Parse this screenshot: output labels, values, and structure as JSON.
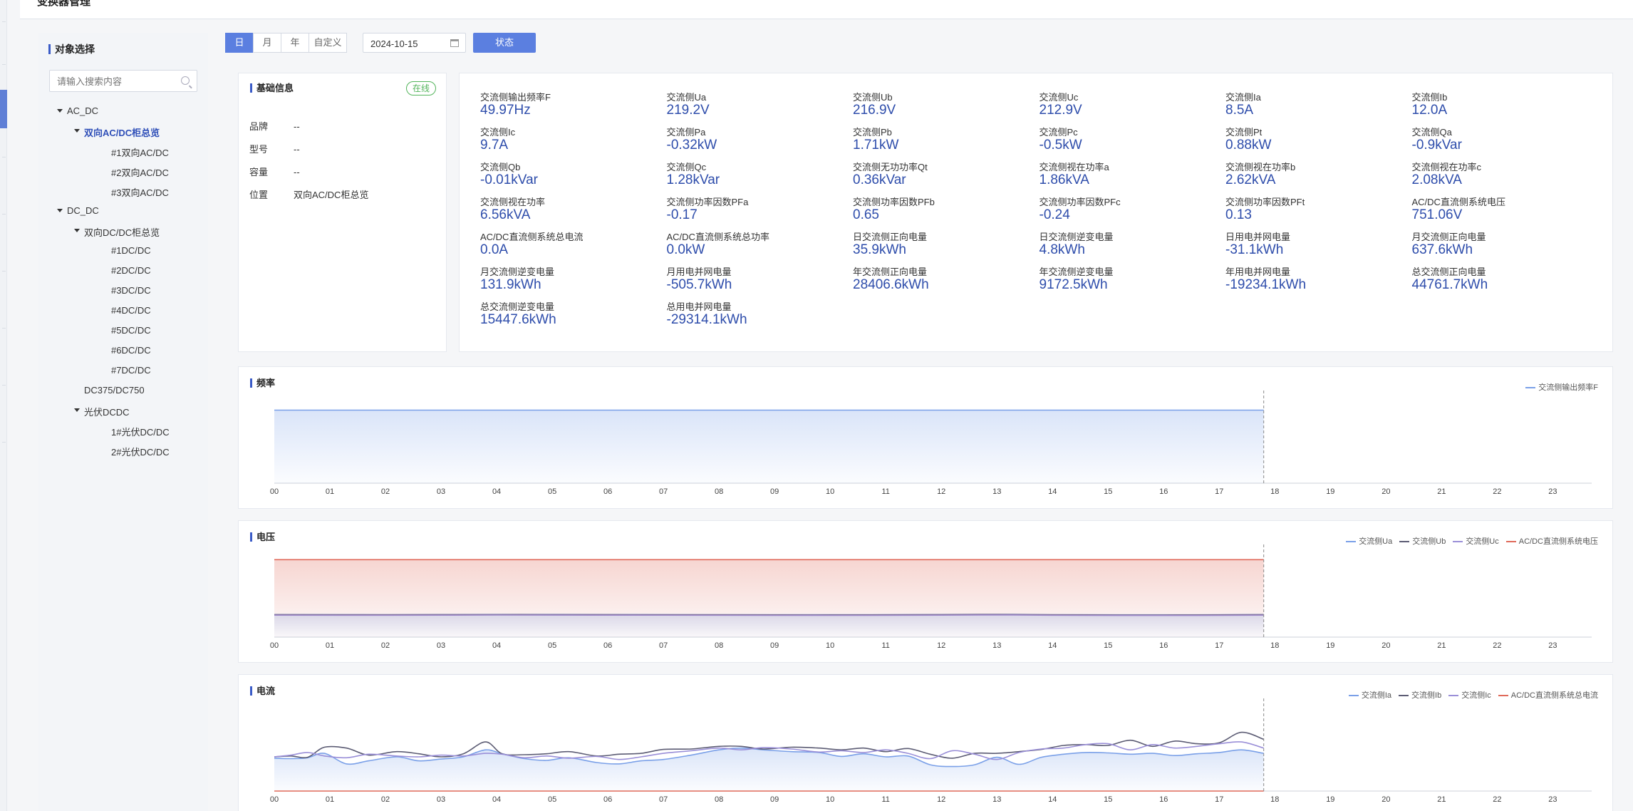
{
  "page": {
    "title": "变换器管理"
  },
  "sidebar": {
    "title": "对象选择",
    "search_placeholder": "请输入搜索内容",
    "tree": [
      {
        "label": "AC_DC",
        "level": 0,
        "expanded": true
      },
      {
        "label": "双向AC/DC柜总览",
        "level": 1,
        "expanded": true,
        "active": true
      },
      {
        "label": "#1双向AC/DC",
        "level": 2
      },
      {
        "label": "#2双向AC/DC",
        "level": 2
      },
      {
        "label": "#3双向AC/DC",
        "level": 2
      },
      {
        "label": "DC_DC",
        "level": 0,
        "expanded": true
      },
      {
        "label": "双向DC/DC柜总览",
        "level": 1,
        "expanded": true
      },
      {
        "label": "#1DC/DC",
        "level": 2
      },
      {
        "label": "#2DC/DC",
        "level": 2
      },
      {
        "label": "#3DC/DC",
        "level": 2
      },
      {
        "label": "#4DC/DC",
        "level": 2
      },
      {
        "label": "#5DC/DC",
        "level": 2
      },
      {
        "label": "#6DC/DC",
        "level": 2
      },
      {
        "label": "#7DC/DC",
        "level": 2
      },
      {
        "label": "DC375/DC750",
        "level": 1
      },
      {
        "label": "光伏DCDC",
        "level": 1,
        "expanded": true
      },
      {
        "label": "1#光伏DC/DC",
        "level": 2
      },
      {
        "label": "2#光伏DC/DC",
        "level": 2
      }
    ]
  },
  "toolbar": {
    "periods": [
      "日",
      "月",
      "年",
      "自定义"
    ],
    "selected_period": "日",
    "date": "2024-10-15",
    "status_label": "状态"
  },
  "info": {
    "title": "基础信息",
    "status": "在线",
    "rows": [
      {
        "key": "品牌",
        "value": "--"
      },
      {
        "key": "型号",
        "value": "--"
      },
      {
        "key": "容量",
        "value": "--"
      },
      {
        "key": "位置",
        "value": "双向AC/DC柜总览"
      }
    ]
  },
  "metrics": [
    {
      "label": "交流侧输出频率F",
      "value": "49.97Hz"
    },
    {
      "label": "交流侧Ua",
      "value": "219.2V"
    },
    {
      "label": "交流侧Ub",
      "value": "216.9V"
    },
    {
      "label": "交流侧Uc",
      "value": "212.9V"
    },
    {
      "label": "交流侧Ia",
      "value": "8.5A"
    },
    {
      "label": "交流侧Ib",
      "value": "12.0A"
    },
    {
      "label": "交流侧Ic",
      "value": "9.7A"
    },
    {
      "label": "交流侧Pa",
      "value": "-0.32kW"
    },
    {
      "label": "交流侧Pb",
      "value": "1.71kW"
    },
    {
      "label": "交流侧Pc",
      "value": "-0.5kW"
    },
    {
      "label": "交流侧Pt",
      "value": "0.88kW"
    },
    {
      "label": "交流侧Qa",
      "value": "-0.9kVar"
    },
    {
      "label": "交流侧Qb",
      "value": "-0.01kVar"
    },
    {
      "label": "交流侧Qc",
      "value": "1.28kVar"
    },
    {
      "label": "交流侧无功功率Qt",
      "value": "0.36kVar"
    },
    {
      "label": "交流侧视在功率a",
      "value": "1.86kVA"
    },
    {
      "label": "交流侧视在功率b",
      "value": "2.62kVA"
    },
    {
      "label": "交流侧视在功率c",
      "value": "2.08kVA"
    },
    {
      "label": "交流侧视在功率",
      "value": "6.56kVA"
    },
    {
      "label": "交流侧功率因数PFa",
      "value": "-0.17"
    },
    {
      "label": "交流侧功率因数PFb",
      "value": "0.65"
    },
    {
      "label": "交流侧功率因数PFc",
      "value": "-0.24"
    },
    {
      "label": "交流侧功率因数PFt",
      "value": "0.13"
    },
    {
      "label": "AC/DC直流侧系统电压",
      "value": "751.06V"
    },
    {
      "label": "AC/DC直流侧系统总电流",
      "value": "0.0A"
    },
    {
      "label": "AC/DC直流侧系统总功率",
      "value": "0.0kW"
    },
    {
      "label": "日交流侧正向电量",
      "value": "35.9kWh"
    },
    {
      "label": "日交流侧逆变电量",
      "value": "4.8kWh"
    },
    {
      "label": "日用电并网电量",
      "value": "-31.1kWh"
    },
    {
      "label": "月交流侧正向电量",
      "value": "637.6kWh"
    },
    {
      "label": "月交流侧逆变电量",
      "value": "131.9kWh"
    },
    {
      "label": "月用电并网电量",
      "value": "-505.7kWh"
    },
    {
      "label": "年交流侧正向电量",
      "value": "28406.6kWh"
    },
    {
      "label": "年交流侧逆变电量",
      "value": "9172.5kWh"
    },
    {
      "label": "年用电并网电量",
      "value": "-19234.1kWh"
    },
    {
      "label": "总交流侧正向电量",
      "value": "44761.7kWh"
    },
    {
      "label": "总交流侧逆变电量",
      "value": "15447.6kWh"
    },
    {
      "label": "总用电并网电量",
      "value": "-29314.1kWh"
    }
  ],
  "chart_data": [
    {
      "type": "area",
      "title": "频率",
      "x": [
        "00",
        "01",
        "02",
        "03",
        "04",
        "05",
        "06",
        "07",
        "08",
        "09",
        "10",
        "11",
        "12",
        "13",
        "14",
        "15",
        "16",
        "17",
        "18",
        "19",
        "20",
        "21",
        "22",
        "23"
      ],
      "current_time": 17.8,
      "ylim": [
        0,
        60
      ],
      "series": [
        {
          "name": "交流侧输出频率F",
          "color": "#7aa0e8",
          "fill": true,
          "points": [
            [
              0,
              50
            ],
            [
              1,
              50
            ],
            [
              2,
              50
            ],
            [
              3,
              50
            ],
            [
              4,
              50
            ],
            [
              5,
              50
            ],
            [
              6,
              50
            ],
            [
              7,
              50
            ],
            [
              8,
              50
            ],
            [
              9,
              50
            ],
            [
              10,
              50
            ],
            [
              11,
              50
            ],
            [
              12,
              50
            ],
            [
              13,
              50
            ],
            [
              14,
              50
            ],
            [
              15,
              50
            ],
            [
              16,
              50
            ],
            [
              17,
              50
            ],
            [
              17.8,
              50
            ]
          ]
        }
      ]
    },
    {
      "type": "area",
      "title": "电压",
      "x": [
        "00",
        "01",
        "02",
        "03",
        "04",
        "05",
        "06",
        "07",
        "08",
        "09",
        "10",
        "11",
        "12",
        "13",
        "14",
        "15",
        "16",
        "17",
        "18",
        "19",
        "20",
        "21",
        "22",
        "23"
      ],
      "current_time": 17.8,
      "ylim": [
        0,
        850
      ],
      "series": [
        {
          "name": "交流侧Ua",
          "color": "#7aa0e8",
          "fill": true,
          "points": [
            [
              0,
              219
            ],
            [
              2,
              218
            ],
            [
              4,
              220
            ],
            [
              6,
              219
            ],
            [
              8,
              218
            ],
            [
              10,
              217
            ],
            [
              12,
              219
            ],
            [
              13,
              221
            ],
            [
              14,
              218
            ],
            [
              16,
              216
            ],
            [
              17.8,
              219
            ]
          ]
        },
        {
          "name": "交流侧Ub",
          "color": "#5c5c74",
          "fill": false,
          "points": [
            [
              0,
              217
            ],
            [
              2,
              216
            ],
            [
              4,
              218
            ],
            [
              6,
              217
            ],
            [
              8,
              216
            ],
            [
              10,
              215
            ],
            [
              12,
              217
            ],
            [
              13,
              219
            ],
            [
              14,
              216
            ],
            [
              16,
              214
            ],
            [
              17.8,
              217
            ]
          ]
        },
        {
          "name": "交流侧Uc",
          "color": "#9a8fd8",
          "fill": false,
          "points": [
            [
              0,
              213
            ],
            [
              2,
              212
            ],
            [
              4,
              214
            ],
            [
              6,
              213
            ],
            [
              8,
              212
            ],
            [
              10,
              211
            ],
            [
              12,
              213
            ],
            [
              13,
              215
            ],
            [
              14,
              212
            ],
            [
              16,
              210
            ],
            [
              17.8,
              213
            ]
          ]
        },
        {
          "name": "AC/DC直流侧系统电压",
          "color": "#e06a5a",
          "fill": true,
          "points": [
            [
              0,
              751
            ],
            [
              17.8,
              751
            ]
          ]
        }
      ]
    },
    {
      "type": "area",
      "title": "电流",
      "x": [
        "00",
        "01",
        "02",
        "03",
        "04",
        "05",
        "06",
        "07",
        "08",
        "09",
        "10",
        "11",
        "12",
        "13",
        "14",
        "15",
        "16",
        "17",
        "18",
        "19",
        "20",
        "21",
        "22",
        "23"
      ],
      "current_time": 17.8,
      "ylim": [
        0,
        20
      ],
      "series": [
        {
          "name": "交流侧Ia",
          "color": "#7aa0e8",
          "fill": true,
          "points": [
            [
              0,
              7.5
            ],
            [
              0.3,
              7.4
            ],
            [
              0.6,
              7.6
            ],
            [
              0.9,
              8.6
            ],
            [
              1.3,
              6.2
            ],
            [
              1.7,
              6.9
            ],
            [
              2.2,
              7.8
            ],
            [
              2.6,
              6.9
            ],
            [
              3.0,
              7.3
            ],
            [
              3.4,
              7.8
            ],
            [
              3.8,
              9.4
            ],
            [
              4.1,
              8.5
            ],
            [
              4.5,
              7.4
            ],
            [
              4.9,
              7.0
            ],
            [
              5.3,
              7.6
            ],
            [
              5.8,
              6.5
            ],
            [
              6.2,
              6.2
            ],
            [
              6.6,
              6.9
            ],
            [
              7.0,
              7.2
            ],
            [
              7.5,
              8.2
            ],
            [
              8.0,
              9.4
            ],
            [
              8.4,
              9.8
            ],
            [
              8.8,
              9.4
            ],
            [
              9.3,
              9.0
            ],
            [
              9.8,
              8.8
            ],
            [
              10.2,
              7.9
            ],
            [
              10.6,
              8.5
            ],
            [
              11.0,
              7.8
            ],
            [
              11.4,
              8.0
            ],
            [
              11.8,
              6.0
            ],
            [
              12.2,
              5.6
            ],
            [
              12.6,
              6.0
            ],
            [
              13.0,
              7.7
            ],
            [
              13.4,
              6.1
            ],
            [
              13.8,
              7.7
            ],
            [
              14.2,
              8.4
            ],
            [
              14.6,
              8.8
            ],
            [
              15.0,
              8.7
            ],
            [
              15.4,
              8.4
            ],
            [
              15.8,
              8.6
            ],
            [
              16.2,
              8.1
            ],
            [
              16.6,
              8.5
            ],
            [
              17.0,
              8.8
            ],
            [
              17.4,
              9.4
            ],
            [
              17.8,
              8.6
            ]
          ]
        },
        {
          "name": "交流侧Ib",
          "color": "#5c5c74",
          "fill": false,
          "points": [
            [
              0,
              7.8
            ],
            [
              0.3,
              8.0
            ],
            [
              0.6,
              7.7
            ],
            [
              0.9,
              10.0
            ],
            [
              1.3,
              9.8
            ],
            [
              1.7,
              8.2
            ],
            [
              2.2,
              9.0
            ],
            [
              2.6,
              8.5
            ],
            [
              3.0,
              7.8
            ],
            [
              3.4,
              8.5
            ],
            [
              3.8,
              11.2
            ],
            [
              4.1,
              8.5
            ],
            [
              4.5,
              8.3
            ],
            [
              4.9,
              8.5
            ],
            [
              5.3,
              9.0
            ],
            [
              5.8,
              8.0
            ],
            [
              6.2,
              8.4
            ],
            [
              6.6,
              8.6
            ],
            [
              7.0,
              9.5
            ],
            [
              7.5,
              9.6
            ],
            [
              8.0,
              10.2
            ],
            [
              8.4,
              10.2
            ],
            [
              8.8,
              9.6
            ],
            [
              9.3,
              10.0
            ],
            [
              9.8,
              9.8
            ],
            [
              10.2,
              9.4
            ],
            [
              10.6,
              9.8
            ],
            [
              11.0,
              9.0
            ],
            [
              11.4,
              9.7
            ],
            [
              11.8,
              8.4
            ],
            [
              12.2,
              7.5
            ],
            [
              12.6,
              8.6
            ],
            [
              13.0,
              8.6
            ],
            [
              13.4,
              9.0
            ],
            [
              13.8,
              9.5
            ],
            [
              14.2,
              10.4
            ],
            [
              14.6,
              10.6
            ],
            [
              15.0,
              10.4
            ],
            [
              15.4,
              11.6
            ],
            [
              15.8,
              10.2
            ],
            [
              16.2,
              11.4
            ],
            [
              16.6,
              10.8
            ],
            [
              17.0,
              11.0
            ],
            [
              17.4,
              13.4
            ],
            [
              17.8,
              11.8
            ]
          ]
        },
        {
          "name": "交流侧Ic",
          "color": "#9a8fd8",
          "fill": false,
          "points": [
            [
              0,
              7.8
            ],
            [
              0.3,
              8.2
            ],
            [
              0.6,
              8.8
            ],
            [
              0.9,
              8.0
            ],
            [
              1.3,
              7.6
            ],
            [
              1.7,
              8.4
            ],
            [
              2.2,
              8.0
            ],
            [
              2.6,
              7.8
            ],
            [
              3.0,
              8.2
            ],
            [
              3.4,
              8.0
            ],
            [
              3.8,
              8.6
            ],
            [
              4.1,
              8.4
            ],
            [
              4.5,
              7.6
            ],
            [
              4.9,
              8.0
            ],
            [
              5.3,
              7.5
            ],
            [
              5.8,
              7.9
            ],
            [
              6.2,
              7.2
            ],
            [
              6.6,
              7.8
            ],
            [
              7.0,
              8.6
            ],
            [
              7.5,
              9.2
            ],
            [
              8.0,
              9.8
            ],
            [
              8.4,
              9.4
            ],
            [
              8.8,
              9.9
            ],
            [
              9.3,
              9.6
            ],
            [
              9.8,
              8.9
            ],
            [
              10.2,
              9.2
            ],
            [
              10.6,
              8.8
            ],
            [
              11.0,
              9.4
            ],
            [
              11.4,
              8.6
            ],
            [
              11.8,
              7.4
            ],
            [
              12.2,
              9.2
            ],
            [
              12.6,
              8.4
            ],
            [
              13.0,
              7.2
            ],
            [
              13.4,
              8.8
            ],
            [
              13.8,
              9.6
            ],
            [
              14.2,
              9.8
            ],
            [
              14.6,
              10.6
            ],
            [
              15.0,
              10.8
            ],
            [
              15.4,
              9.4
            ],
            [
              15.8,
              10.6
            ],
            [
              16.2,
              9.8
            ],
            [
              16.6,
              10.2
            ],
            [
              17.0,
              10.8
            ],
            [
              17.4,
              11.2
            ],
            [
              17.8,
              9.8
            ]
          ]
        },
        {
          "name": "AC/DC直流侧系统总电流",
          "color": "#e06a5a",
          "fill": false,
          "points": [
            [
              0,
              0
            ],
            [
              17.8,
              0
            ]
          ]
        }
      ]
    }
  ]
}
